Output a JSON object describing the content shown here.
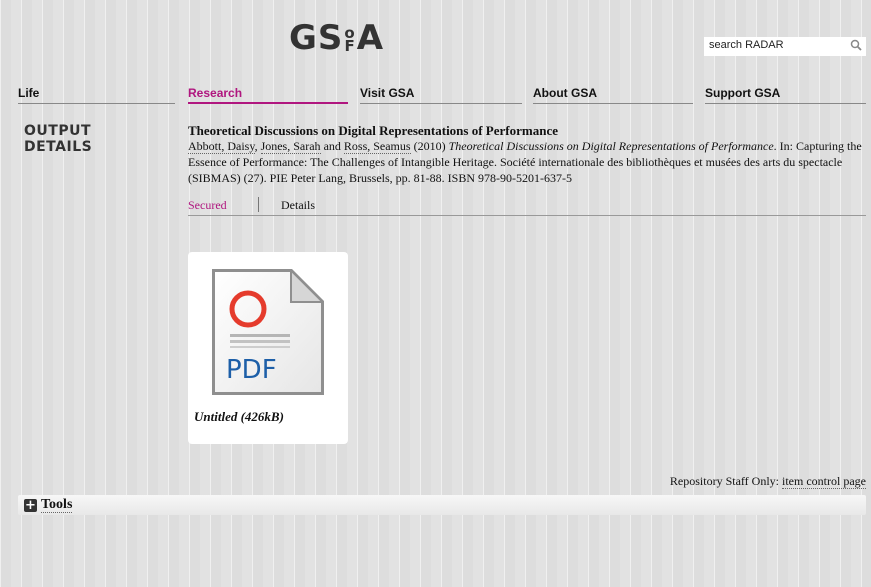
{
  "logo": {
    "left": "GS",
    "small_top": "o",
    "small_bottom": "F",
    "right": "A"
  },
  "search": {
    "value": "search RADAR"
  },
  "nav": {
    "items": [
      {
        "label": "Life"
      },
      {
        "label": "Research"
      },
      {
        "label": "Visit GSA"
      },
      {
        "label": "About GSA"
      },
      {
        "label": "Support GSA"
      }
    ],
    "active": "Research"
  },
  "section_title": {
    "line1": "OUTPUT",
    "line2": "DETAILS"
  },
  "output": {
    "title": "Theoretical Discussions on Digital Representations of Performance",
    "authors": {
      "a1": "Abbott, Daisy",
      "sep1": ", ",
      "a2": "Jones, Sarah",
      "sep2": " and ",
      "a3": "Ross, Seamus",
      "year": " (2010) "
    },
    "italic_title": "Theoretical Discussions on Digital Representations of Performance",
    "rest": ". In: Capturing the Essence of Performance: The Challenges of Intangible Heritage. Société internationale des bibliothèques et musées des arts du spectacle (SIBMAS) (27). PIE Peter Lang, Brussels, pp. 81-88. ISBN 978-90-5201-637-5"
  },
  "tabs": {
    "secured": "Secured",
    "details": "Details"
  },
  "document": {
    "icon_label": "PDF",
    "name": "Untitled (426kB)"
  },
  "staff": {
    "prefix": "Repository Staff Only: ",
    "link": "item control page"
  },
  "tools": {
    "plus": "+",
    "label": "Tools"
  },
  "colors": {
    "accent": "#b0167f",
    "background": "#e2e2e2",
    "pdf_blue": "#1d5fa8",
    "pdf_red": "#e53b2c"
  }
}
